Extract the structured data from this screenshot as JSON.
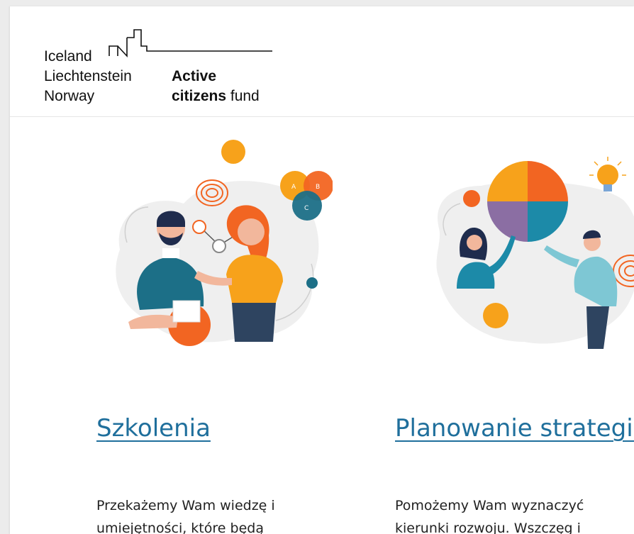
{
  "header": {
    "logo": {
      "countries": [
        "Iceland",
        "Liechtenstein",
        "Norway"
      ],
      "brand_line1": "Active",
      "brand_line2_strong": "citizens",
      "brand_line2_rest": " fund"
    }
  },
  "cards": [
    {
      "title": "Szkolenia",
      "text_line1": "Przekażemy Wam wiedzę i",
      "text_line2": "umiejętności, które będą"
    },
    {
      "title": "Planowanie strategiczne",
      "text_line1": "Pomożemy Wam wyznaczyć",
      "text_line2": "kierunki rozwoju. Wszczęg i"
    }
  ],
  "colors": {
    "link": "#1f6f9c",
    "orange": "#f26522",
    "yellow_orange": "#f7a21b",
    "teal": "#1c6f87",
    "purple": "#8b6ea3"
  }
}
